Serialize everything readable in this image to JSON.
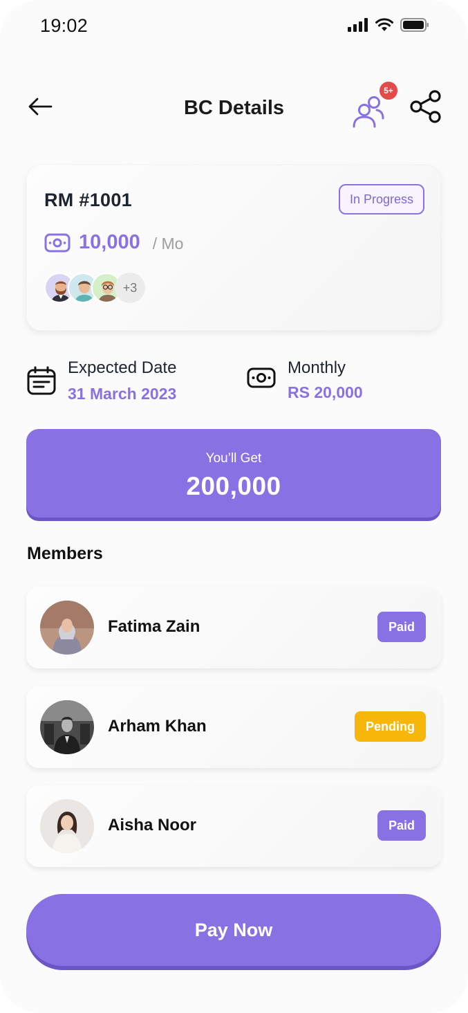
{
  "status_bar": {
    "time": "19:02"
  },
  "header": {
    "title": "BC Details",
    "notification_badge": "5+"
  },
  "summary": {
    "title": "RM #1001",
    "status": "In Progress",
    "amount": "10,000",
    "unit": "/ Mo",
    "extra_members": "+3"
  },
  "info": {
    "expected_label": "Expected Date",
    "expected_value": "31 March 2023",
    "monthly_label": "Monthly",
    "monthly_value": "RS 20,000"
  },
  "banner": {
    "label": "You’ll Get",
    "value": "200,000"
  },
  "members_section": {
    "title": "Members"
  },
  "members": [
    {
      "name": "Fatima Zain",
      "status": "Paid"
    },
    {
      "name": "Arham Khan",
      "status": "Pending"
    },
    {
      "name": "Aisha Noor",
      "status": "Paid"
    }
  ],
  "pay_button": {
    "label": "Pay Now"
  },
  "colors": {
    "accent": "#8872e3",
    "pending": "#f6b60a",
    "badge": "#e34b4b"
  }
}
